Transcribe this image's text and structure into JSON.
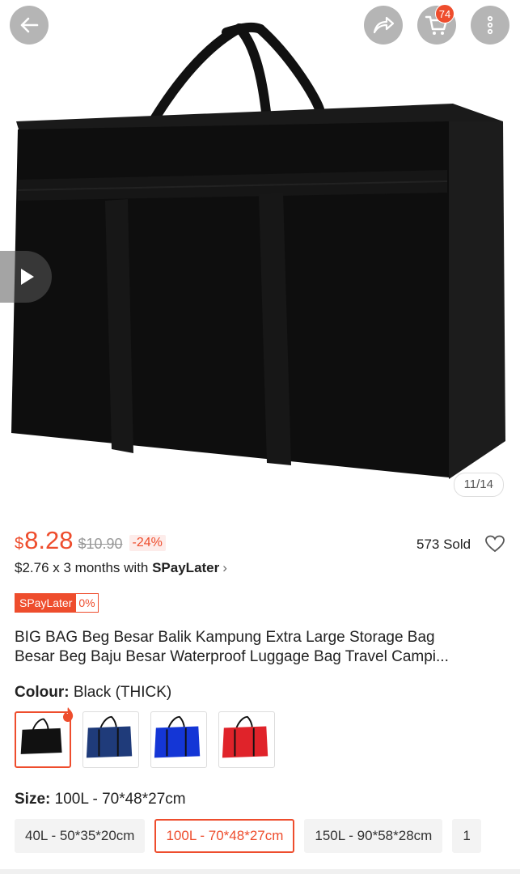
{
  "header": {
    "back_icon": "arrow-left-icon",
    "share_icon": "share-icon",
    "cart_icon": "cart-icon",
    "cart_badge": "74",
    "more_icon": "more-vertical-icon"
  },
  "gallery": {
    "image_counter": "11/14",
    "video_icon": "play-icon",
    "image_subject": "black storage bag"
  },
  "price": {
    "currency": "$",
    "current": "8.28",
    "original": "$10.90",
    "discount": "-24%",
    "sold": "573 Sold",
    "installment_prefix": "$2.76 x 3 months with ",
    "installment_brand": "SPayLater",
    "installment_chevron": "›"
  },
  "spaylater_tag": {
    "label": "SPayLater",
    "rate": "0%"
  },
  "product": {
    "title_line1": "BIG BAG Beg Besar Balik Kampung Extra Large Storage Bag",
    "title_line2": "Besar Beg Baju Besar Waterproof Luggage Bag Travel Campi..."
  },
  "colour": {
    "label": "Colour:",
    "selected": " Black (THICK)",
    "options": [
      {
        "color": "#111111"
      },
      {
        "color": "#1f3b7a"
      },
      {
        "color": "#1436d6"
      },
      {
        "color": "#e0232a"
      }
    ]
  },
  "size": {
    "label": "Size:",
    "selected": " 100L - 70*48*27cm",
    "options": [
      {
        "label": "40L - 50*35*20cm"
      },
      {
        "label": "100L - 70*48*27cm"
      },
      {
        "label": "150L - 90*58*28cm"
      },
      {
        "label": "1"
      }
    ]
  },
  "colors": {
    "accent": "#ee4d2d"
  }
}
